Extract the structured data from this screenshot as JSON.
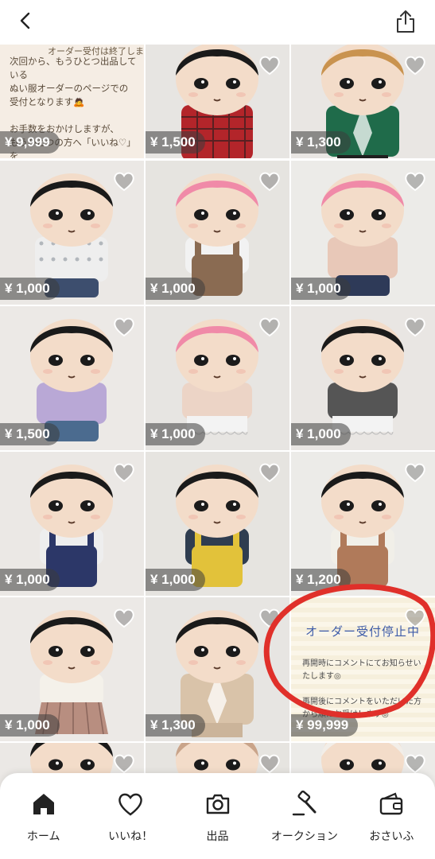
{
  "header": {
    "back_icon": "chevron-left-icon",
    "share_icon": "share-icon"
  },
  "items": [
    {
      "price": "¥ 9,999",
      "kind": "note",
      "note_heading": "オーダー受付は終了しま",
      "note_text": "次回から、もうひとつ出品している\nぬい服オーダーのページでの\n受付となります🙇\n\nお手数をおかけしますが、\nもうひとつの方へ「いいね♡」を\nしていただき、お待ちください🙇"
    },
    {
      "price": "¥ 1,500",
      "kind": "doll",
      "hair": "#1a1a1a",
      "top": "#b3252a",
      "bottom": "#2b2b2b",
      "pattern": "plaid"
    },
    {
      "price": "¥ 1,300",
      "kind": "doll",
      "hair": "#c9934f",
      "top": "#1f6b4a",
      "bottom": "#1f1f1f",
      "pattern": "jacket"
    },
    {
      "price": "¥ 1,000",
      "kind": "doll",
      "hair": "#1a1a1a",
      "top": "#eeeeee",
      "bottom": "#3d4e6e",
      "pattern": "floral"
    },
    {
      "price": "¥ 1,000",
      "kind": "doll",
      "hair": "#f08aa8",
      "top": "#f2f2f2",
      "bottom": "#8a6b52",
      "pattern": "overall"
    },
    {
      "price": "¥ 1,000",
      "kind": "doll",
      "hair": "#f08aa8",
      "top": "#e8c8b8",
      "bottom": "#2e3a58",
      "pattern": "plain"
    },
    {
      "price": "¥ 1,500",
      "kind": "doll",
      "hair": "#1a1a1a",
      "top": "#b9a8d6",
      "bottom": "#4b6b8f",
      "pattern": "plain"
    },
    {
      "price": "¥ 1,000",
      "kind": "doll",
      "hair": "#f08aa8",
      "top": "#ecd4c6",
      "bottom": "#f3f3f3",
      "pattern": "lace"
    },
    {
      "price": "¥ 1,000",
      "kind": "doll",
      "hair": "#1a1a1a",
      "top": "#555555",
      "bottom": "#f3f3f3",
      "pattern": "lace"
    },
    {
      "price": "¥ 1,000",
      "kind": "doll",
      "hair": "#1a1a1a",
      "top": "#eeeeee",
      "bottom": "#2c3768",
      "pattern": "overall"
    },
    {
      "price": "¥ 1,000",
      "kind": "doll",
      "hair": "#1a1a1a",
      "top": "#2f3d50",
      "bottom": "#e2c23a",
      "pattern": "overall"
    },
    {
      "price": "¥ 1,200",
      "kind": "doll",
      "hair": "#1a1a1a",
      "top": "#f1efe8",
      "bottom": "#b07a5a",
      "pattern": "overall"
    },
    {
      "price": "¥ 1,000",
      "kind": "doll",
      "hair": "#1a1a1a",
      "top": "#f4f1ea",
      "bottom": "#b88e80",
      "pattern": "plaid-skirt"
    },
    {
      "price": "¥ 1,300",
      "kind": "doll",
      "hair": "#1a1a1a",
      "top": "#d9c3a9",
      "bottom": "#cbb49a",
      "pattern": "jacket"
    },
    {
      "price": "¥ 99,999",
      "kind": "closed",
      "closed_title": "オーダー受付停止中",
      "closed_text": "再開時にコメントにてお知らせい\nたします◎\n\n再開後にコメントをいただいた方\nから順にお受け！ます◎"
    },
    {
      "price": "",
      "kind": "partial",
      "hair": "#1a1a1a",
      "top": "#888888",
      "bottom": "#555555",
      "pattern": "plain"
    },
    {
      "price": "",
      "kind": "partial",
      "hair": "#c9a48a",
      "top": "#c9a48a",
      "bottom": "#555555",
      "pattern": "plain"
    },
    {
      "price": "",
      "kind": "partial",
      "hair": "#f2eee8",
      "top": "#f2eee8",
      "bottom": "#555555",
      "pattern": "plain"
    }
  ],
  "bottom_nav": [
    {
      "label": "ホーム",
      "icon": "home-icon"
    },
    {
      "label": "いいね！",
      "icon": "heart-icon"
    },
    {
      "label": "出品",
      "icon": "camera-icon"
    },
    {
      "label": "オークション",
      "icon": "gavel-icon"
    },
    {
      "label": "おさいふ",
      "icon": "wallet-icon"
    }
  ],
  "colors": {
    "accent": "#e0302a",
    "closed_title": "#3d5ba8",
    "nav_text": "#222222"
  }
}
